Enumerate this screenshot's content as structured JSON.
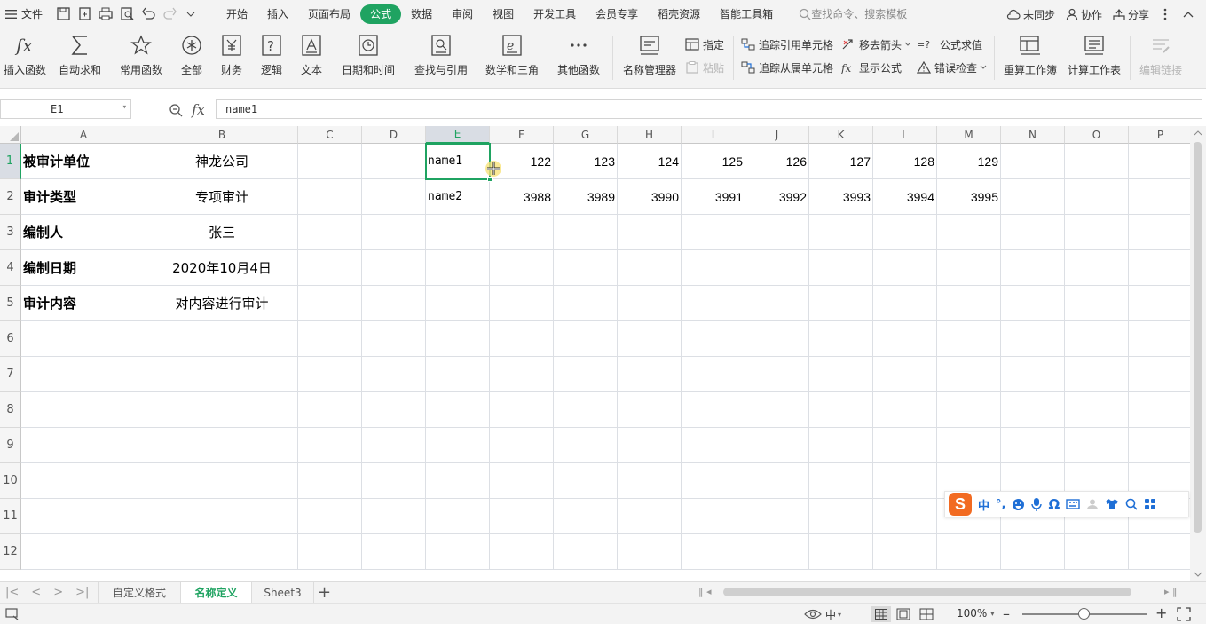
{
  "topbar": {
    "menu_label": "文件",
    "tabs": [
      "开始",
      "插入",
      "页面布局",
      "公式",
      "数据",
      "审阅",
      "视图",
      "开发工具",
      "会员专享",
      "稻壳资源",
      "智能工具箱"
    ],
    "active_tab": "公式",
    "search_placeholder": "查找命令、搜索模板",
    "sync": "未同步",
    "collab": "协作",
    "share": "分享"
  },
  "ribbon": {
    "big": [
      "插入函数",
      "自动求和",
      "常用函数",
      "全部",
      "财务",
      "逻辑",
      "文本",
      "日期和时间",
      "查找与引用",
      "数学和三角",
      "其他函数",
      "名称管理器",
      "重算工作簿",
      "计算工作表",
      "编辑链接"
    ],
    "small": {
      "assign": "指定",
      "paste": "粘贴",
      "trace_prec": "追踪引用单元格",
      "trace_dep": "追踪从属单元格",
      "remove_arrows": "移去箭头",
      "show_formula": "显示公式",
      "eval_formula": "公式求值",
      "error_check": "错误检查"
    }
  },
  "formula": {
    "name_box": "E1",
    "fx": "fx",
    "value": "name1"
  },
  "columns": [
    "A",
    "B",
    "C",
    "D",
    "E",
    "F",
    "G",
    "H",
    "I",
    "J",
    "K",
    "L",
    "M",
    "N",
    "O",
    "P"
  ],
  "rows": [
    "1",
    "2",
    "3",
    "4",
    "5",
    "6",
    "7",
    "8",
    "9",
    "10",
    "11",
    "12"
  ],
  "cells": {
    "A1": "被审计单位",
    "B1": "神龙公司",
    "E1": "name1",
    "F1": "122",
    "G1": "123",
    "H1": "124",
    "I1": "125",
    "J1": "126",
    "K1": "127",
    "L1": "128",
    "M1": "129",
    "A2": "审计类型",
    "B2": "专项审计",
    "E2": "name2",
    "F2": "3988",
    "G2": "3989",
    "H2": "3990",
    "I2": "3991",
    "J2": "3992",
    "K2": "3993",
    "L2": "3994",
    "M2": "3995",
    "A3": "编制人",
    "B3": "张三",
    "A4": "编制日期",
    "B4": "2020年10月4日",
    "A5": "审计内容",
    "B5": "对内容进行审计"
  },
  "sheets": [
    "自定义格式",
    "名称定义",
    "Sheet3"
  ],
  "active_sheet": "名称定义",
  "status": {
    "ime_mode": "中",
    "zoom": "100%"
  },
  "ime_bar": {
    "logo": "S",
    "mode": "中",
    "punct": "°,"
  },
  "colors": {
    "accent": "#1fa361"
  }
}
